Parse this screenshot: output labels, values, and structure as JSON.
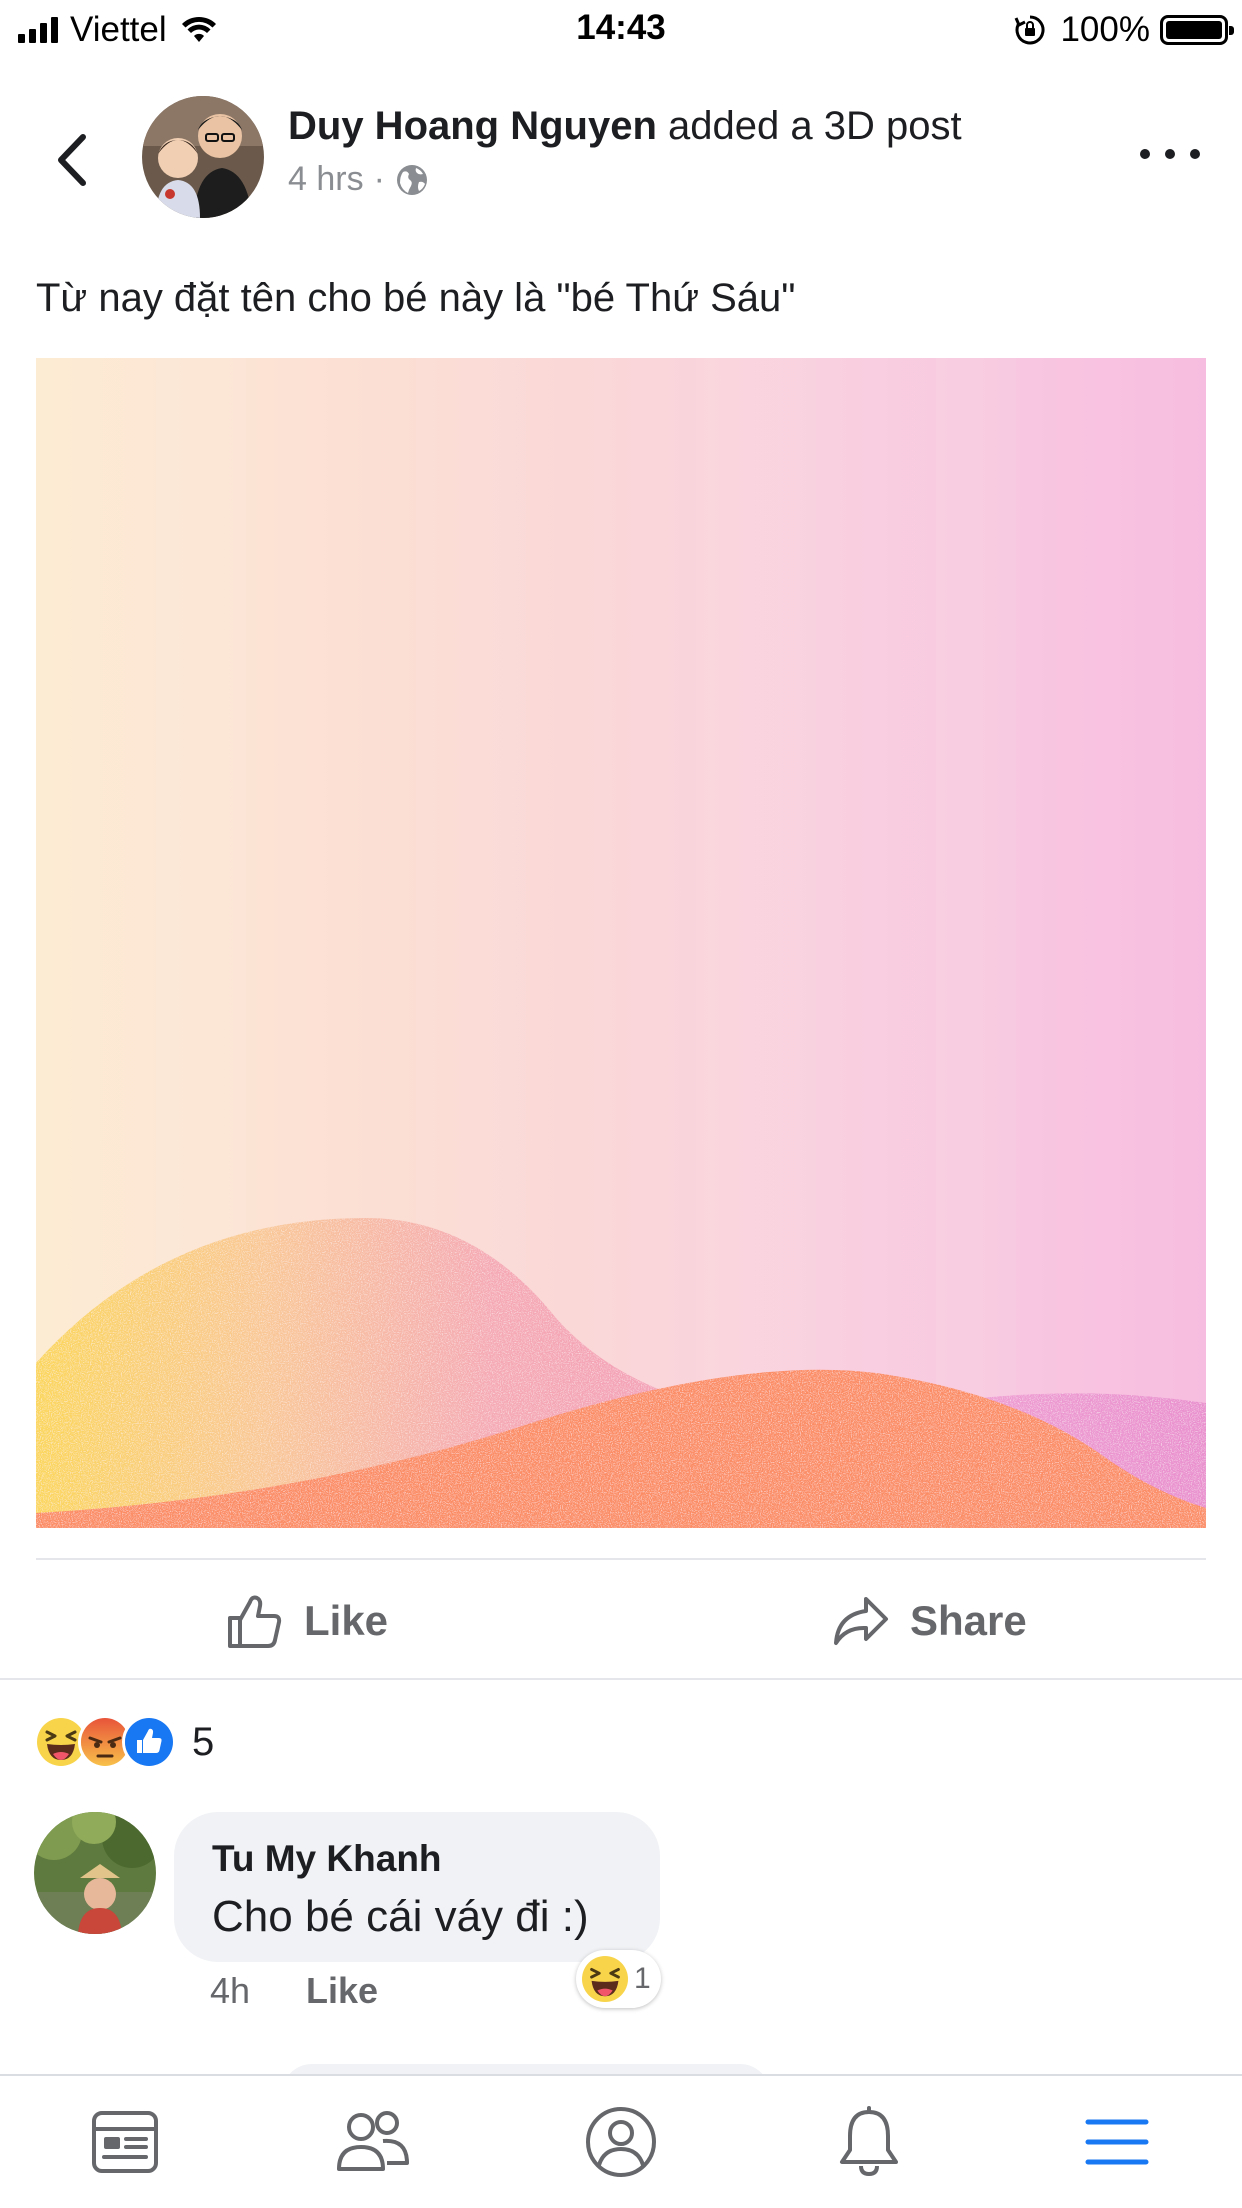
{
  "status_bar": {
    "carrier": "Viettel",
    "time": "14:43",
    "battery": "100%"
  },
  "post": {
    "author": "Duy Hoang Nguyen",
    "action": "added a 3D post",
    "time": "4 hrs",
    "privacy_icon": "globe-icon",
    "caption": "Từ nay đặt tên cho bé này là \"bé Thứ Sáu\""
  },
  "actions": {
    "like_label": "Like",
    "share_label": "Share"
  },
  "reactions": {
    "types": [
      "haha",
      "angry",
      "like"
    ],
    "count": "5"
  },
  "comment": {
    "author": "Tu My Khanh",
    "text": "Cho bé cái váy đi :)",
    "time": "4h",
    "like_label": "Like",
    "reaction": "haha",
    "reaction_count": "1"
  },
  "tab_bar": {
    "items": [
      "news-feed-icon",
      "friends-icon",
      "profile-icon",
      "notifications-icon",
      "menu-icon"
    ],
    "active": "menu-icon"
  },
  "colors": {
    "accent": "#1877f2",
    "text": "#1c1e21",
    "secondary_text": "#65676b",
    "hill_orange": "#fb8c64",
    "sky_left": "#fdebd3",
    "sky_right": "#f8c4e0"
  }
}
